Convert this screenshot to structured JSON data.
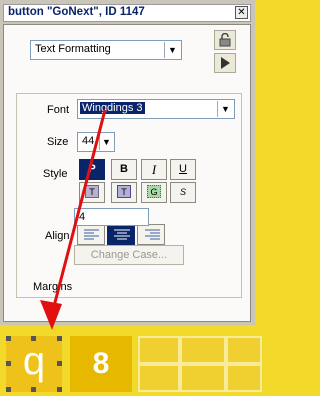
{
  "window": {
    "title": "button \"GoNext\", ID 1147",
    "close_glyph": "✕"
  },
  "panel_selector": {
    "value": "Text Formatting"
  },
  "lock_icon": "unlock-icon",
  "play_icon": "play-icon",
  "font": {
    "label": "Font",
    "value": "Wingdings 3"
  },
  "size": {
    "label": "Size",
    "value": "44"
  },
  "style": {
    "label": "Style",
    "buttons": [
      {
        "name": "plain",
        "glyph": "P",
        "active": true
      },
      {
        "name": "bold",
        "glyph": "B",
        "active": false
      },
      {
        "name": "italic",
        "glyph": "I",
        "active": false
      },
      {
        "name": "underline",
        "glyph": "U",
        "active": false
      },
      {
        "name": "shadow",
        "glyph": "T",
        "active": false
      },
      {
        "name": "outline",
        "glyph": "T",
        "active": false
      },
      {
        "name": "emboss",
        "glyph": "G",
        "active": false
      },
      {
        "name": "extend",
        "glyph": "S",
        "active": false
      }
    ]
  },
  "align": {
    "label": "Align",
    "options": [
      "left",
      "center",
      "right"
    ],
    "selected": "center"
  },
  "margins": {
    "label": "Margins",
    "value": "4"
  },
  "change_case": {
    "label": "Change Case..."
  },
  "card": {
    "tile_q": "q",
    "tile_8": "8"
  },
  "colors": {
    "background": "#f3da2a",
    "selection": "#0a246a",
    "arrow": "#e01010"
  }
}
